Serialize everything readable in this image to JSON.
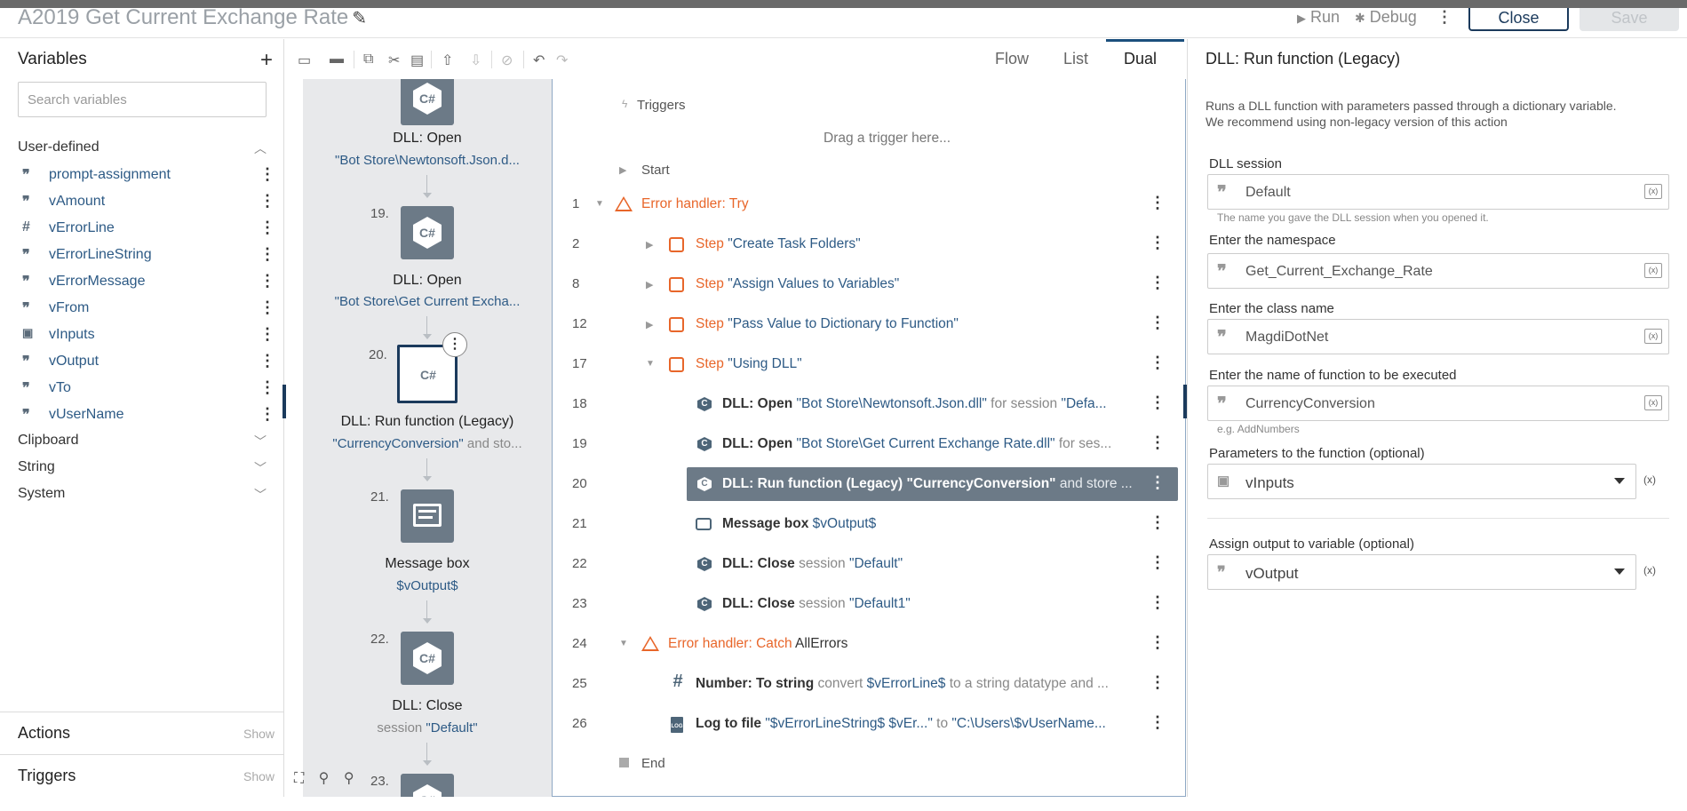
{
  "window": {
    "title": "A2019 Get Current Exchange Rate",
    "run_label": "Run",
    "debug_label": "Debug",
    "close_label": "Close",
    "save_label": "Save"
  },
  "variables": {
    "title": "Variables",
    "search_placeholder": "Search variables",
    "user_defined_label": "User-defined",
    "items": [
      {
        "name": "prompt-assignment",
        "type": "string-icon"
      },
      {
        "name": "vAmount",
        "type": "string-icon"
      },
      {
        "name": "vErrorLine",
        "type": "number-icon"
      },
      {
        "name": "vErrorLineString",
        "type": "string-icon"
      },
      {
        "name": "vErrorMessage",
        "type": "string-icon"
      },
      {
        "name": "vFrom",
        "type": "string-icon"
      },
      {
        "name": "vInputs",
        "type": "dictionary-icon"
      },
      {
        "name": "vOutput",
        "type": "string-icon"
      },
      {
        "name": "vTo",
        "type": "string-icon"
      },
      {
        "name": "vUserName",
        "type": "string-icon"
      }
    ],
    "sections": [
      "Clipboard",
      "String",
      "System"
    ],
    "actions_label": "Actions",
    "triggers_label": "Triggers",
    "show_label": "Show"
  },
  "view_tabs": {
    "flow": "Flow",
    "list": "List",
    "dual": "Dual"
  },
  "flow_nodes": [
    {
      "num": "",
      "title": "DLL: Open",
      "sub_value": "\"Bot Store\\Newtonsoft.Json.d...",
      "sub_text": ""
    },
    {
      "num": "19.",
      "title": "DLL: Open",
      "sub_value": "\"Bot Store\\Get Current Excha...",
      "sub_text": ""
    },
    {
      "num": "20.",
      "title": "DLL: Run function (Legacy)",
      "sub_value": "\"CurrencyConversion\"",
      "sub_text": " and sto..."
    },
    {
      "num": "21.",
      "title": "Message box",
      "sub_value": "$vOutput$",
      "sub_text": ""
    },
    {
      "num": "22.",
      "title": "DLL: Close",
      "sub_value": "\"Default\"",
      "sub_text": "session "
    },
    {
      "num": "23.",
      "title": "",
      "sub_value": "",
      "sub_text": ""
    }
  ],
  "list": {
    "triggers_label": "Triggers",
    "drag_hint": "Drag a trigger here...",
    "start_label": "Start",
    "end_label": "End",
    "rows": [
      {
        "num": "1",
        "kind": "Error handler: Try",
        "detail": ""
      },
      {
        "num": "2",
        "kind": "Step",
        "detail": "\"Create Task Folders\""
      },
      {
        "num": "8",
        "kind": "Step",
        "detail": "\"Assign Values to Variables\""
      },
      {
        "num": "12",
        "kind": "Step",
        "detail": "\"Pass Value to Dictionary to Function\""
      },
      {
        "num": "17",
        "kind": "Step",
        "detail": "\"Using DLL\""
      },
      {
        "num": "18",
        "kind": "DLL: Open",
        "v1": "\"Bot Store\\Newtonsoft.Json.dll\"",
        "g1": " for session ",
        "v2": "\"Defa..."
      },
      {
        "num": "19",
        "kind": "DLL: Open",
        "v1": "\"Bot Store\\Get Current Exchange Rate.dll\"",
        "g1": " for ses...",
        "v2": ""
      },
      {
        "num": "20",
        "kind": "DLL: Run function (Legacy) \"CurrencyConversion\"",
        "g1": " and store ..."
      },
      {
        "num": "21",
        "kind": "Message box",
        "v1": "$vOutput$"
      },
      {
        "num": "22",
        "kind": "DLL: Close",
        "g1": " session ",
        "v1": "\"Default\""
      },
      {
        "num": "23",
        "kind": "DLL: Close",
        "g1": " session ",
        "v1": "\"Default1\""
      },
      {
        "num": "24",
        "kind": "Error handler: Catch",
        "detail": "AllErrors"
      },
      {
        "num": "25",
        "kind": "Number: To string",
        "g1": " convert ",
        "v1": "$vErrorLine$",
        "g2": " to a string datatype and ..."
      },
      {
        "num": "26",
        "kind": "Log to file",
        "v1": "\"$vErrorLineString$ $vEr...\"",
        "g1": " to ",
        "v2": "\"C:\\Users\\$vUserName..."
      }
    ]
  },
  "properties": {
    "title": "DLL: Run function (Legacy)",
    "description_1": "Runs a DLL function with parameters passed through a dictionary variable.",
    "description_2": "We recommend using non-legacy version of this action",
    "dll_session_label": "DLL session",
    "dll_session_value": "Default",
    "dll_session_hint": "The name you gave the DLL session when you opened it.",
    "namespace_label": "Enter the namespace",
    "namespace_value": "Get_Current_Exchange_Rate",
    "class_label": "Enter the class name",
    "class_value": "MagdiDotNet",
    "function_label": "Enter the name of function to be executed",
    "function_value": "CurrencyConversion",
    "function_hint": "e.g. AddNumbers",
    "params_label": "Parameters to the function (optional)",
    "params_value": "vInputs",
    "output_label": "Assign output to variable (optional)",
    "output_value": "vOutput",
    "fx_label": "(x)"
  }
}
